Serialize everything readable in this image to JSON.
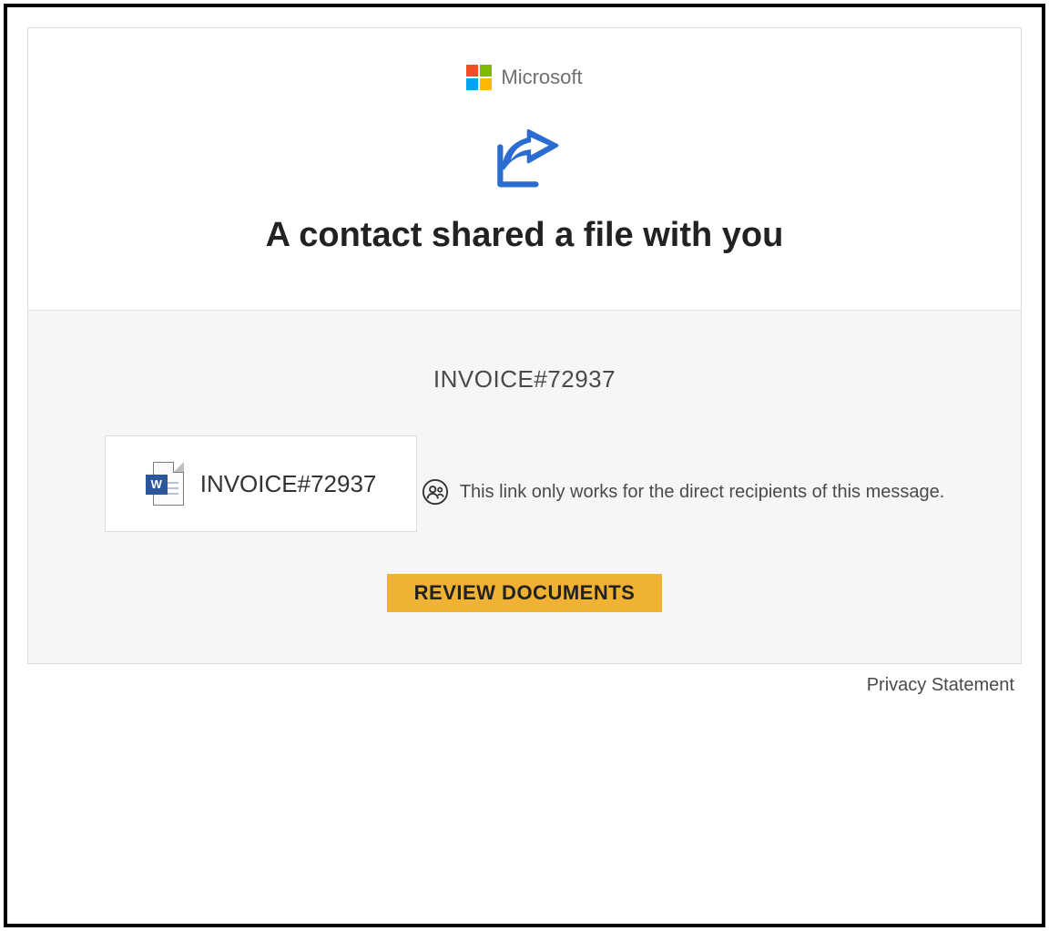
{
  "brand": {
    "name": "Microsoft"
  },
  "header": {
    "headline": "A contact shared a file with you"
  },
  "body": {
    "document_title": "INVOICE#72937",
    "file_name": "INVOICE#72937",
    "recipients_note": "This link only works for the direct recipients of this message.",
    "cta_label": "REVIEW DOCUMENTS"
  },
  "footer": {
    "privacy_label": "Privacy Statement"
  },
  "icons": {
    "share": "share-arrow-icon",
    "people": "people-circle-icon",
    "word": "word-document-icon",
    "ms_logo": "microsoft-logo-icon"
  },
  "colors": {
    "accent": "#2b6cd1",
    "cta_bg": "#f0b232"
  }
}
